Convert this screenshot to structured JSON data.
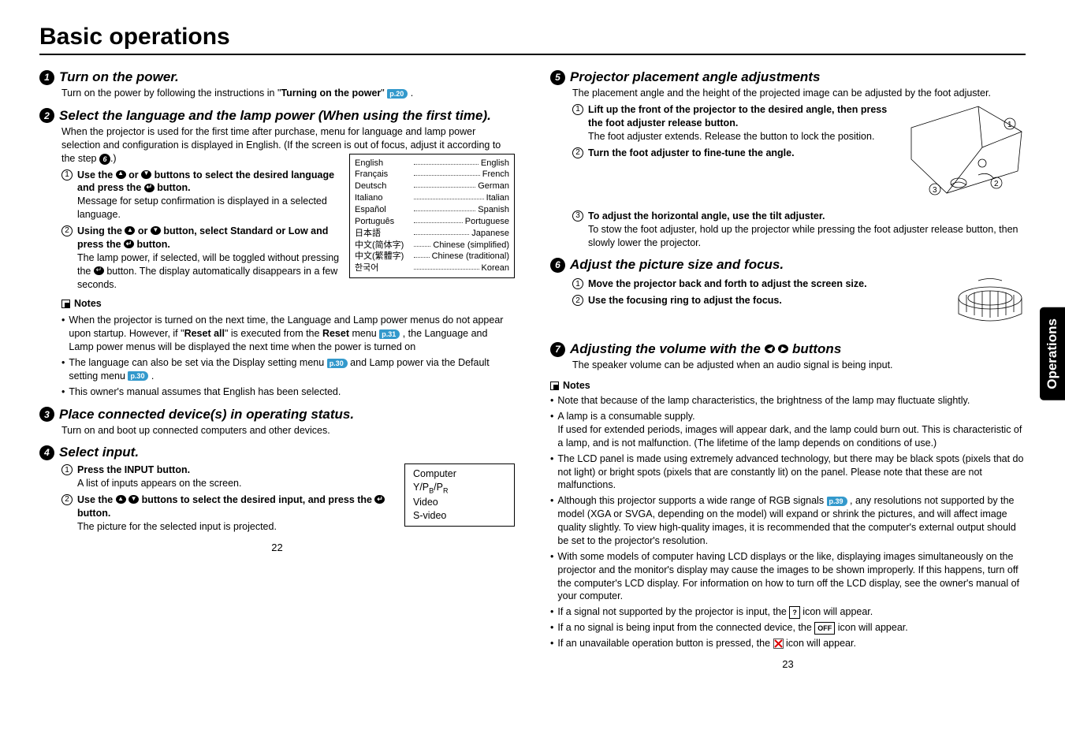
{
  "title": "Basic operations",
  "side_tab": "Operations",
  "page_left": "22",
  "page_right": "23",
  "steps": {
    "s1": {
      "title": "Turn on the power.",
      "body_pre": "Turn on the power by following the instructions in \"",
      "body_bold": "Turning on the power",
      "body_post": "\" ",
      "ref": "p.20",
      "period": " ."
    },
    "s2": {
      "title": "Select the language and the lamp power (When using the first time).",
      "intro": "When the projector is used for the first time after purchase, menu for language and lamp power selection and configuration is displayed in English. (If the screen is out of focus, adjust it according to the step ",
      "intro_ref_num": "6",
      "intro_end": ".)",
      "sub1_title_a": "Use the ",
      "sub1_title_b": " or ",
      "sub1_title_c": " buttons to select the desired language and press the ",
      "sub1_title_d": " button.",
      "sub1_body": "Message for setup confirmation is displayed in a selected language.",
      "sub2_title_a": "Using the ",
      "sub2_title_b": " or ",
      "sub2_title_c": " button, select Standard or Low and press the ",
      "sub2_title_d": " button.",
      "sub2_body_a": "The lamp power, if selected, will be toggled without pressing the ",
      "sub2_body_b": " button. The display automatically disappears in a few seconds.",
      "notes_label": "Notes",
      "note1_a": "When the projector is turned on the next time, the Language and Lamp power menus do not appear upon startup. However, if \"",
      "note1_bold": "Reset all",
      "note1_b": "\" is executed from the ",
      "note1_bold2": "Reset",
      "note1_c": " menu ",
      "note1_ref": "p.31",
      "note1_d": " , the Language and Lamp power menus will be displayed the next time when the power is turned on",
      "note2_a": "The language can also be set via the Display setting menu ",
      "note2_ref1": "p.30",
      "note2_b": "  and Lamp power via the Default setting menu ",
      "note2_ref2": "p.30",
      "note2_c": " .",
      "note3": "This owner's manual assumes that English has been selected."
    },
    "lang_table": [
      {
        "native": "English",
        "en": "English"
      },
      {
        "native": "Français",
        "en": "French"
      },
      {
        "native": "Deutsch",
        "en": "German"
      },
      {
        "native": "Italiano",
        "en": "Italian"
      },
      {
        "native": "Español",
        "en": "Spanish"
      },
      {
        "native": "Português",
        "en": "Portuguese"
      },
      {
        "native": "日本語",
        "en": "Japanese"
      },
      {
        "native": "中文(简体字)",
        "en": "Chinese (simplified)"
      },
      {
        "native": "中文(繁體字)",
        "en": "Chinese (traditional)"
      },
      {
        "native": "한국어",
        "en": "Korean"
      }
    ],
    "s3": {
      "title": "Place connected device(s) in operating status.",
      "body": "Turn on and boot up connected computers and other devices."
    },
    "s4": {
      "title": "Select input.",
      "sub1_title": "Press the INPUT button.",
      "sub1_body": "A list of inputs appears on the screen.",
      "sub2_title_a": "Use the ",
      "sub2_title_b": " buttons to select the desired input, and press the ",
      "sub2_title_c": " button.",
      "sub2_body": "The picture for the selected input is projected.",
      "inputs": [
        "Computer",
        "Y/PB/PR",
        "Video",
        "S-video"
      ]
    },
    "s5": {
      "title": "Projector placement angle adjustments",
      "intro": "The placement angle and the height of the projected image can be adjusted by the foot adjuster.",
      "sub1_title": "Lift up the front of the projector to the desired angle, then press the foot adjuster release button.",
      "sub1_body": "The foot adjuster extends. Release the button to lock the position.",
      "sub2_title": "Turn the foot adjuster to fine-tune the angle.",
      "sub3_title": "To adjust the horizontal angle, use the tilt adjuster.",
      "sub3_body": "To stow the foot adjuster, hold up the projector while pressing the foot adjuster release button, then slowly lower the projector."
    },
    "s6": {
      "title": "Adjust the picture size and focus.",
      "sub1_title": "Move the projector back and forth to adjust the screen size.",
      "sub2_title": "Use the focusing ring to adjust the focus."
    },
    "s7": {
      "title_a": "Adjusting the volume with the ",
      "title_b": " buttons",
      "body": "The speaker volume can be adjusted when an audio signal is being input."
    },
    "right_notes": {
      "label": "Notes",
      "n1": "Note that because of the lamp characteristics, the brightness of the lamp may fluctuate slightly.",
      "n2a": "A lamp is a consumable supply.",
      "n2b": "If used for extended periods, images will appear dark, and the lamp could burn out.  This is characteristic of a lamp, and is not malfunction. (The lifetime of the lamp depends on conditions of use.)",
      "n3": "The LCD panel is made using extremely advanced technology, but there may be black spots (pixels that do not light) or bright spots (pixels that are constantly lit) on the panel. Please note that these are not malfunctions.",
      "n4a": "Although this projector supports a wide range of RGB signals ",
      "n4ref": "p.39",
      "n4b": " , any resolutions not supported by the model (XGA or SVGA, depending on the model) will expand or shrink the pictures, and will affect image quality slightly. To view high-quality images, it is recommended that the computer's external output should be set to the projector's resolution.",
      "n5": "With some models of computer having LCD displays or the like, displaying images simultaneously on the projector and the monitor's display may cause the images to be shown improperly. If this happens, turn off the computer's LCD display. For information on how to turn off the LCD display, see the owner's manual of your computer.",
      "n6a": "If a signal not supported by the projector is input, the ",
      "n6b": " icon will appear.",
      "n7a": "If a no signal is being input from the connected device, the ",
      "n7b": " icon will appear.",
      "n8a": "If an unavailable operation button is pressed, the ",
      "n8b": " icon will appear.",
      "off_label": "OFF",
      "q_label": "?"
    }
  }
}
